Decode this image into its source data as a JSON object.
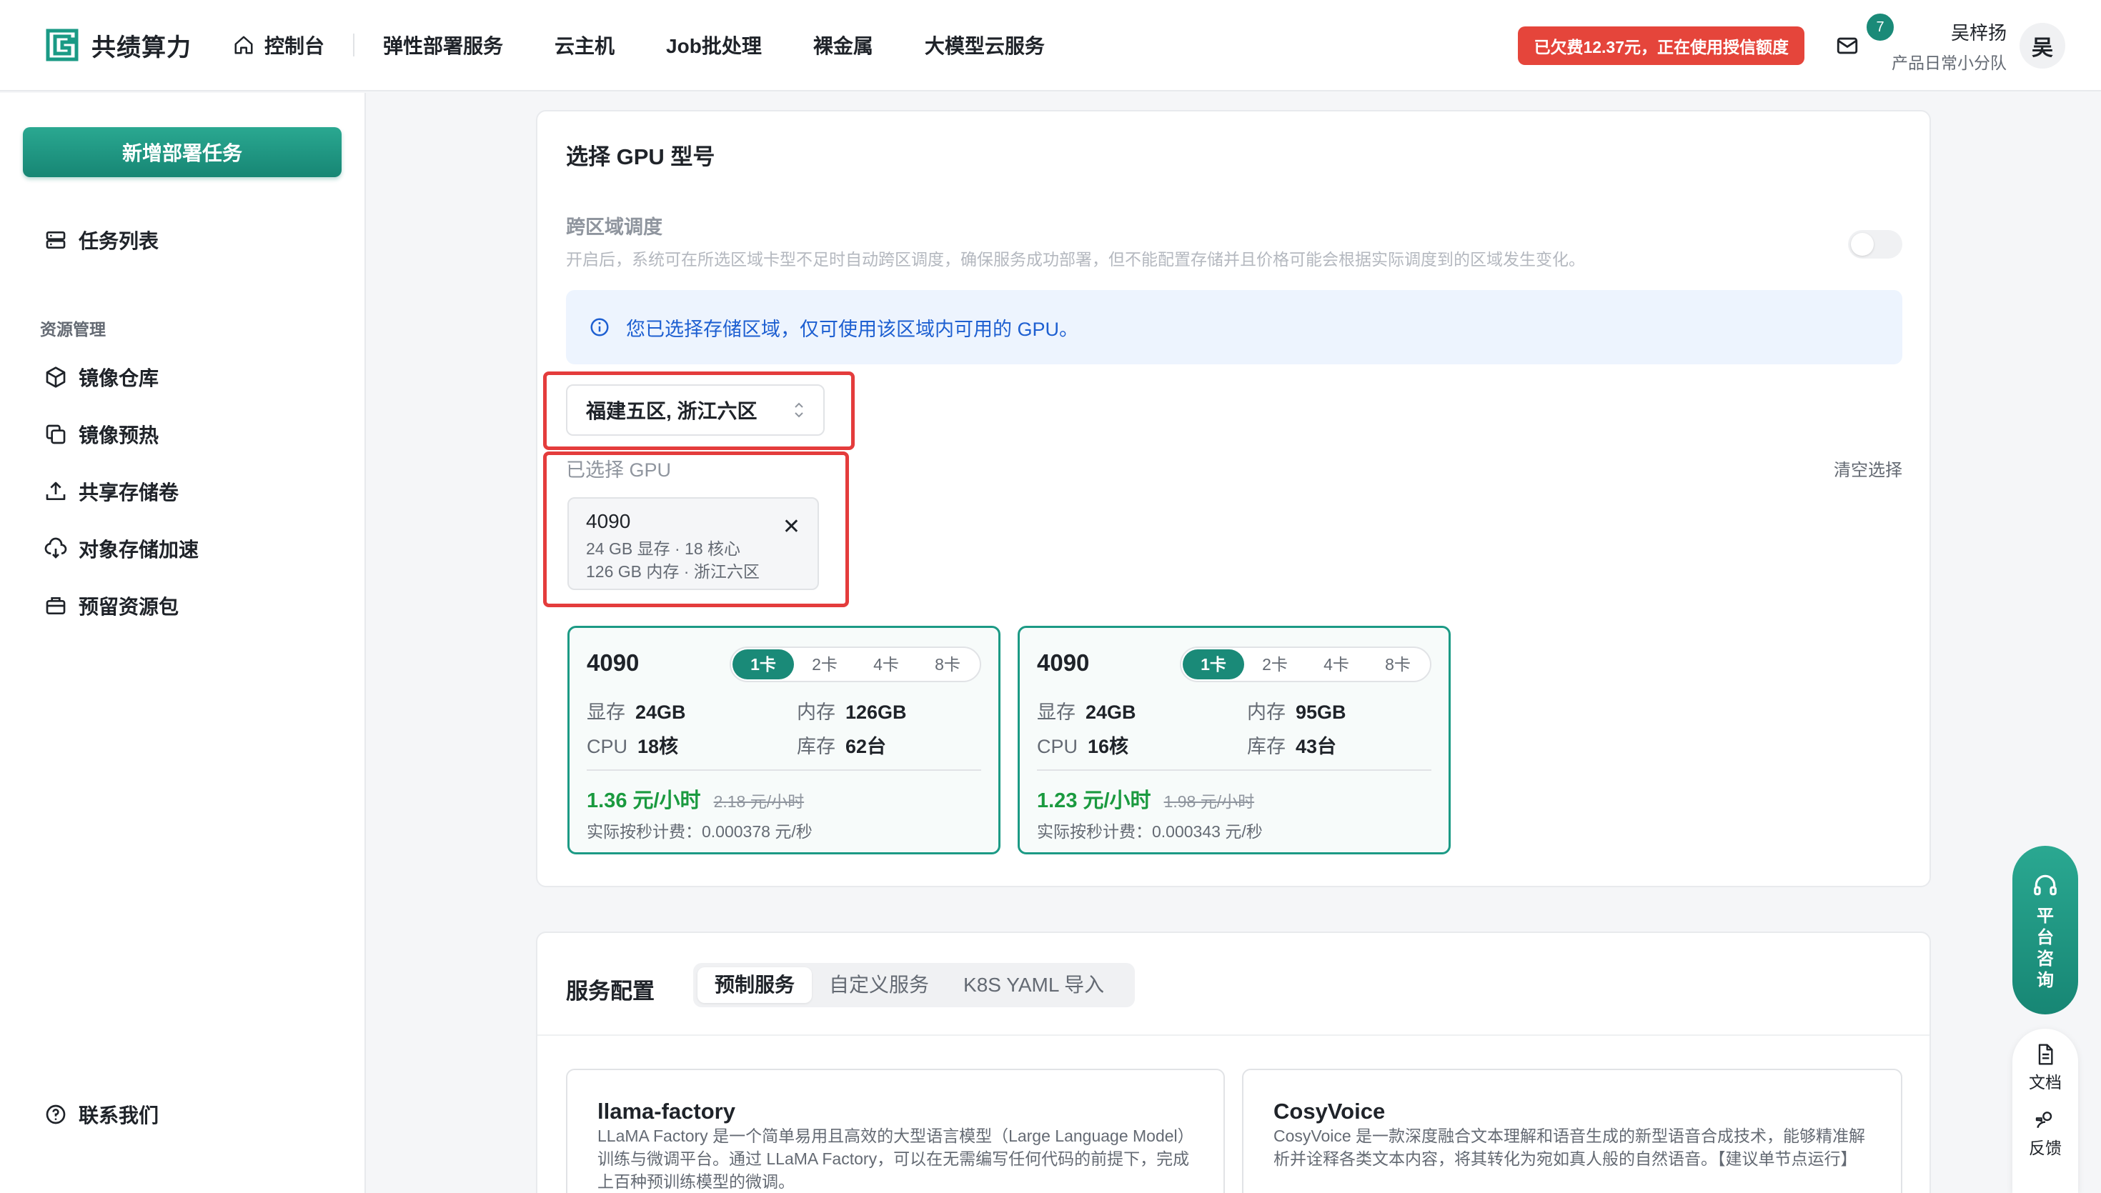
{
  "brand": {
    "name": "共绩算力",
    "accent": "#1a8a78"
  },
  "nav": {
    "home": "控制台",
    "items": [
      "弹性部署服务",
      "云主机",
      "Job批处理",
      "裸金属",
      "大模型云服务"
    ]
  },
  "header": {
    "debt_badge": "已欠费12.37元，正在使用授信额度",
    "mail_count": "7",
    "user_name": "吴梓扬",
    "user_team": "产品日常小分队",
    "avatar_char": "吴"
  },
  "sidebar": {
    "new_task": "新增部署任务",
    "task_list": "任务列表",
    "group_resources": "资源管理",
    "items": [
      "镜像仓库",
      "镜像预热",
      "共享存储卷",
      "对象存储加速",
      "预留资源包"
    ],
    "contact": "联系我们"
  },
  "gpu_section": {
    "title": "选择 GPU 型号",
    "cross_region_title": "跨区域调度",
    "cross_region_desc": "开启后，系统可在所选区域卡型不足时自动跨区调度，确保服务成功部署，但不能配置存储并且价格可能会根据实际调度到的区域发生变化。",
    "cross_region_enabled": false,
    "info_text": "您已选择存储区域，仅可使用该区域内可用的 GPU。",
    "region_value": "福建五区, 浙江六区",
    "selected_label": "已选择 GPU",
    "clear_label": "清空选择",
    "selected_chip": {
      "name": "4090",
      "line1": "24 GB 显存 · 18 核心",
      "line2": "126 GB 内存 · 浙江六区"
    },
    "cards": [
      {
        "name": "4090",
        "options": [
          "1卡",
          "2卡",
          "4卡",
          "8卡"
        ],
        "active_option": "1卡",
        "vram_label": "显存",
        "vram": "24GB",
        "mem_label": "内存",
        "mem": "126GB",
        "cpu_label": "CPU",
        "cpu": "18核",
        "stock_label": "库存",
        "stock": "62台",
        "price": "1.36 元/小时",
        "price_old": "2.18 元/小时",
        "sec_price": "实际按秒计费：0.000378 元/秒"
      },
      {
        "name": "4090",
        "options": [
          "1卡",
          "2卡",
          "4卡",
          "8卡"
        ],
        "active_option": "1卡",
        "vram_label": "显存",
        "vram": "24GB",
        "mem_label": "内存",
        "mem": "95GB",
        "cpu_label": "CPU",
        "cpu": "16核",
        "stock_label": "库存",
        "stock": "43台",
        "price": "1.23 元/小时",
        "price_old": "1.98 元/小时",
        "sec_price": "实际按秒计费：0.000343 元/秒"
      }
    ]
  },
  "service_section": {
    "title": "服务配置",
    "tabs": [
      "预制服务",
      "自定义服务",
      "K8S YAML 导入"
    ],
    "templates": [
      {
        "name": "llama-factory",
        "desc": "LLaMA Factory 是一个简单易用且高效的大型语言模型（Large Language Model）训练与微调平台。通过 LLaMA Factory，可以在无需编写任何代码的前提下，完成上百种预训练模型的微调。"
      },
      {
        "name": "CosyVoice",
        "desc": "CosyVoice 是一款深度融合文本理解和语音生成的新型语音合成技术，能够精准解析并诠释各类文本内容，将其转化为宛如真人般的自然语音。【建议单节点运行】"
      }
    ]
  },
  "float": {
    "consult": "平台咨询",
    "docs": "文档",
    "feedback": "反馈"
  }
}
